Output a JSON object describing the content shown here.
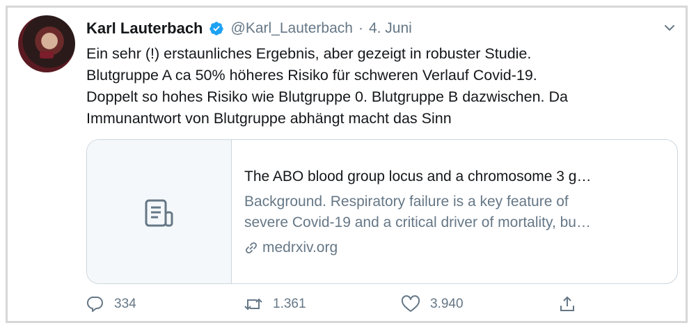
{
  "author": {
    "name": "Karl Lauterbach",
    "handle": "@Karl_Lauterbach",
    "separator": "·",
    "date": "4. Juni",
    "verified": true,
    "avatar_icon": "profile-photo"
  },
  "tweet": {
    "lines": [
      "Ein sehr (!) erstaunliches Ergebnis, aber gezeigt in robuster Studie.",
      "Blutgruppe A ca 50% höheres Risiko für schweren Verlauf Covid-19.",
      "Doppelt so hohes Risiko wie Blutgruppe 0. Blutgruppe B dazwischen. Da",
      "Immunantwort von Blutgruppe abhängt macht das Sinn"
    ]
  },
  "card": {
    "title": "The ABO blood group locus and a chromosome 3 g…",
    "description_lines": [
      "Background. Respiratory failure is a key feature of",
      "severe Covid-19 and a critical driver of mortality, bu…"
    ],
    "domain": "medrxiv.org",
    "thumb_icon": "document-icon"
  },
  "actions": {
    "reply_count": "334",
    "retweet_count": "1.361",
    "like_count": "3.940"
  },
  "colors": {
    "verified": "#1da1f2",
    "secondary_text": "#657786",
    "border": "#ccd6dd"
  }
}
